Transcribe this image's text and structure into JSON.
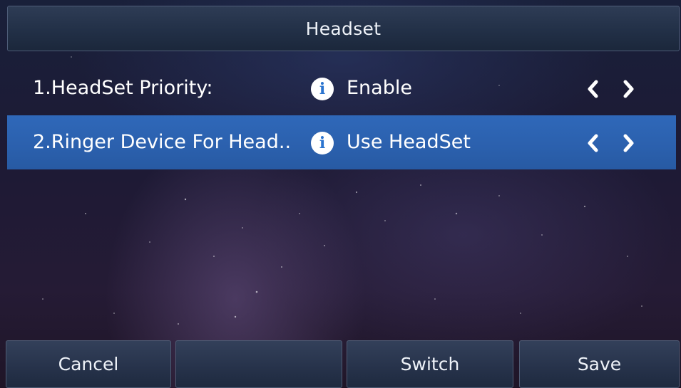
{
  "header": {
    "title": "Headset"
  },
  "settings": [
    {
      "label": "1.HeadSet Priority:",
      "info_icon": "info-icon",
      "value": "Enable",
      "selected": false
    },
    {
      "label": "2.Ringer Device For Head..",
      "info_icon": "info-icon",
      "value": "Use HeadSet",
      "selected": true
    }
  ],
  "softkeys": {
    "cancel": "Cancel",
    "empty": "",
    "switch": "Switch",
    "save": "Save"
  },
  "colors": {
    "selected_row": "#2b60ad",
    "info_icon": "#2b74cf",
    "text": "#ffffff"
  }
}
